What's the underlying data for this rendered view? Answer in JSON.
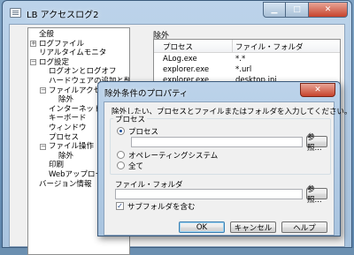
{
  "window": {
    "title": "LB アクセスログ2",
    "close_glyph": "✕",
    "min_glyph": "▁",
    "max_glyph": "□"
  },
  "tree": {
    "items": [
      {
        "label": "全般",
        "level": 0,
        "expander": ""
      },
      {
        "label": "ログファイル",
        "level": 0,
        "expander": "+"
      },
      {
        "label": "リアルタイムモニタ",
        "level": 0,
        "expander": ""
      },
      {
        "label": "ログ設定",
        "level": 0,
        "expander": "−"
      },
      {
        "label": "ログオンとログオフ",
        "level": 1,
        "expander": ""
      },
      {
        "label": "ハードウェアの追加と削除",
        "level": 1,
        "expander": ""
      },
      {
        "label": "ファイルアクセス",
        "level": 1,
        "expander": "−"
      },
      {
        "label": "除外",
        "level": 2,
        "expander": ""
      },
      {
        "label": "インターネットアドレス",
        "level": 1,
        "expander": ""
      },
      {
        "label": "キーボード",
        "level": 1,
        "expander": ""
      },
      {
        "label": "ウィンドウ",
        "level": 1,
        "expander": ""
      },
      {
        "label": "プロセス",
        "level": 1,
        "expander": ""
      },
      {
        "label": "ファイル操作",
        "level": 1,
        "expander": "−"
      },
      {
        "label": "除外",
        "level": 2,
        "expander": ""
      },
      {
        "label": "印刷",
        "level": 1,
        "expander": ""
      },
      {
        "label": "Webアップロード",
        "level": 1,
        "expander": ""
      },
      {
        "label": "バージョン情報",
        "level": 0,
        "expander": ""
      }
    ]
  },
  "exclusion": {
    "label": "除外",
    "columns": [
      "プロセス",
      "ファイル・フォルダ"
    ],
    "rows": [
      [
        "ALog.exe",
        "*.*"
      ],
      [
        "explorer.exe",
        "*.url"
      ],
      [
        "explorer.exe",
        "desktop.ini"
      ]
    ]
  },
  "dialog": {
    "title": "除外条件のプロパティ",
    "close_glyph": "✕",
    "instruction": "除外したい、プロセスとファイルまたはフォルダを入力してください。",
    "process_group": "プロセス",
    "radio_process": "プロセス",
    "radio_os": "オペレーティングシステム",
    "radio_all": "全て",
    "process_value": "",
    "browse1": "参照...",
    "file_group": "ファイル・フォルダ",
    "file_value": "",
    "browse2": "参照...",
    "subfolder_label": "サブフォルダを含む",
    "subfolder_checked": true,
    "ok": "OK",
    "cancel": "キャンセル",
    "help": "ヘルプ"
  }
}
